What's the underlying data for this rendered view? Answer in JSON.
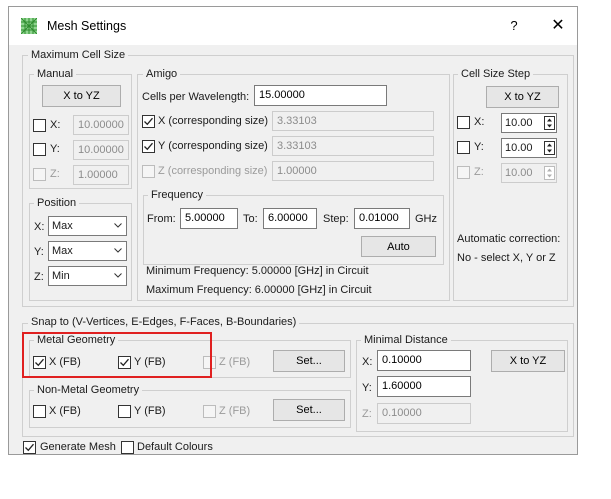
{
  "window": {
    "title": "Mesh Settings",
    "help": "?",
    "close": "✕"
  },
  "max_cell": {
    "title": "Maximum Cell Size",
    "manual": {
      "title": "Manual",
      "button": "X to YZ",
      "x": {
        "label": "X:",
        "value": "10.00000",
        "checked": false
      },
      "y": {
        "label": "Y:",
        "value": "10.00000",
        "checked": false
      },
      "z": {
        "label": "Z:",
        "value": "1.00000",
        "checked": false
      }
    },
    "amigo": {
      "title": "Amigo",
      "cells_label": "Cells per Wavelength:",
      "cells_value": "15.00000",
      "x": {
        "label": "X (corresponding size)",
        "value": "3.33103",
        "checked": true
      },
      "y": {
        "label": "Y (corresponding size)",
        "value": "3.33103",
        "checked": true
      },
      "z": {
        "label": "Z (corresponding size)",
        "value": "1.00000",
        "checked": false
      },
      "frequency": {
        "title": "Frequency",
        "from_label": "From:",
        "from_value": "5.00000",
        "to_label": "To:",
        "to_value": "6.00000",
        "step_label": "Step:",
        "step_value": "0.01000",
        "unit": "GHz",
        "auto_button": "Auto"
      },
      "min_freq": "Minimum Frequency: 5.00000 [GHz] in Circuit",
      "max_freq": "Maximum Frequency: 6.00000 [GHz] in Circuit"
    },
    "position": {
      "title": "Position",
      "x": {
        "label": "X:",
        "value": "Max"
      },
      "y": {
        "label": "Y:",
        "value": "Max"
      },
      "z": {
        "label": "Z:",
        "value": "Min"
      }
    },
    "step": {
      "title": "Cell Size Step",
      "button": "X to YZ",
      "x": {
        "label": "X:",
        "value": "10.00",
        "checked": false
      },
      "y": {
        "label": "Y:",
        "value": "10.00",
        "checked": false
      },
      "z": {
        "label": "Z:",
        "value": "10.00",
        "checked": false
      },
      "auto_correction": "Automatic correction:",
      "auto_correction_value": "No - select X, Y or Z"
    }
  },
  "snap": {
    "title": "Snap to (V-Vertices, E-Edges, F-Faces, B-Boundaries)",
    "metal": {
      "title": "Metal Geometry",
      "x": {
        "label": "X (FB)",
        "checked": true
      },
      "y": {
        "label": "Y (FB)",
        "checked": true
      },
      "z": {
        "label": "Z (FB)",
        "checked": false
      },
      "set_button": "Set..."
    },
    "nonmetal": {
      "title": "Non-Metal Geometry",
      "x": {
        "label": "X (FB)",
        "checked": false
      },
      "y": {
        "label": "Y (FB)",
        "checked": false
      },
      "z": {
        "label": "Z (FB)",
        "checked": false
      },
      "set_button": "Set..."
    },
    "min_dist": {
      "title": "Minimal Distance",
      "x": {
        "label": "X:",
        "value": "0.10000"
      },
      "y": {
        "label": "Y:",
        "value": "1.60000"
      },
      "z": {
        "label": "Z:",
        "value": "0.10000"
      },
      "button": "X to YZ"
    }
  },
  "footer": {
    "generate_mesh": {
      "label": "Generate Mesh",
      "checked": true
    },
    "default_colours": {
      "label": "Default Colours",
      "checked": false
    }
  },
  "colors": {
    "highlight": "#e02020",
    "dialog_bg": "#f0f0f0"
  }
}
